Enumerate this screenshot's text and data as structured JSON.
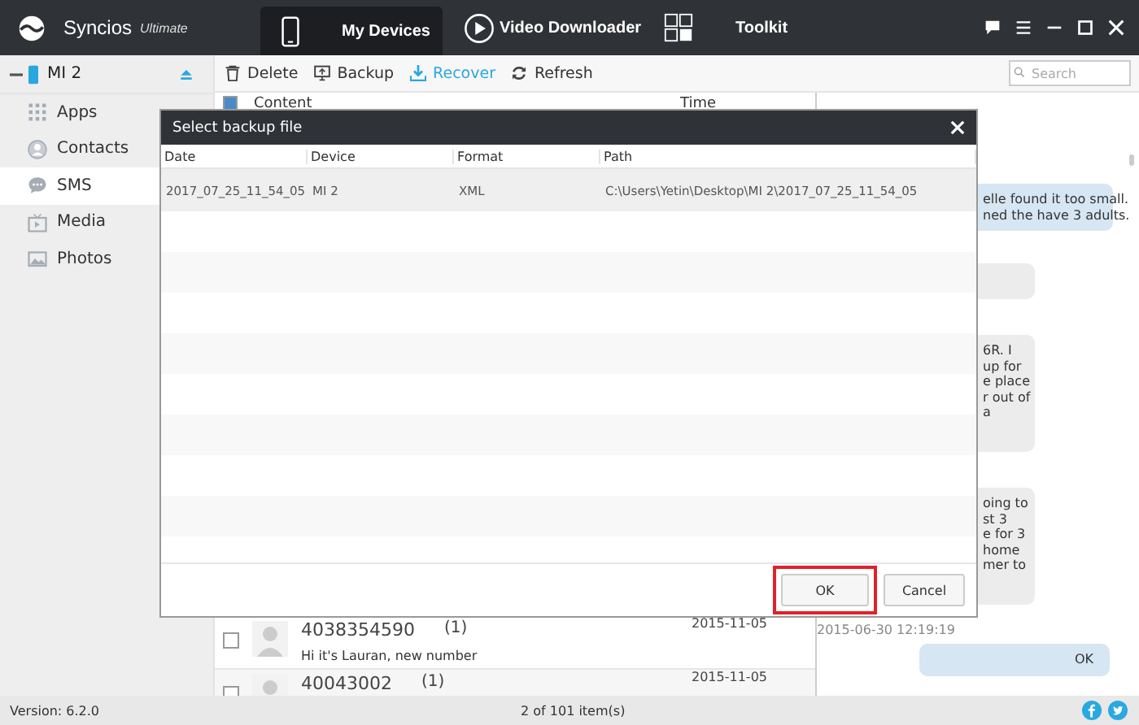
{
  "app": {
    "name": "Syncios",
    "edition": "Ultimate"
  },
  "nav_tabs": [
    {
      "label": "My Devices",
      "selected": true
    },
    {
      "label": "Video Downloader",
      "selected": false
    },
    {
      "label": "Toolkit",
      "selected": false
    }
  ],
  "device": {
    "name": "MI 2"
  },
  "sidebar": [
    {
      "label": "Apps",
      "selected": false
    },
    {
      "label": "Contacts",
      "selected": false
    },
    {
      "label": "SMS",
      "selected": true
    },
    {
      "label": "Media",
      "selected": false
    },
    {
      "label": "Photos",
      "selected": false
    }
  ],
  "toolbar": [
    {
      "label": "Delete",
      "active": false
    },
    {
      "label": "Backup",
      "active": false
    },
    {
      "label": "Recover",
      "active": true
    },
    {
      "label": "Refresh",
      "active": false
    }
  ],
  "search": {
    "placeholder": "Search"
  },
  "list": {
    "select_all_checked": true,
    "columns": [
      "Content",
      "Time"
    ],
    "rows": [
      {
        "contact": "4038354590",
        "count": "(1)",
        "preview": "Hi it's Lauran, new number",
        "time": "2015-11-05",
        "checked": false
      },
      {
        "contact": "40043002",
        "count": "(1)",
        "time": "2015-11-05",
        "checked": false
      }
    ]
  },
  "chat": [
    {
      "kind": "sent",
      "lines": [
        "elle found it too small.",
        "ned the have 3 adults."
      ]
    },
    {
      "kind": "received"
    },
    {
      "kind": "received",
      "lines": [
        "6R. I",
        "up for",
        "e place",
        "r out of",
        "a"
      ]
    },
    {
      "kind": "received",
      "lines": [
        "oing to",
        "st 3",
        "e for 3",
        "home",
        "mer to"
      ]
    },
    {
      "kind": "timestamp",
      "lines": [
        "2015-06-30 12:19:19"
      ]
    },
    {
      "kind": "sent",
      "lines": [
        "OK"
      ]
    }
  ],
  "dialog": {
    "title": "Select backup file",
    "columns": [
      "Date",
      "Device",
      "Format",
      "Path"
    ],
    "rows": [
      {
        "cells": [
          "2017_07_25_11_54_05",
          "MI 2",
          "XML",
          "C:\\Users\\Yetin\\Desktop\\MI 2\\2017_07_25_11_54_05"
        ],
        "selected": true
      }
    ],
    "buttons": [
      {
        "label": "OK",
        "highlighted": true
      },
      {
        "label": "Cancel",
        "highlighted": false
      }
    ]
  },
  "status_bar": {
    "version": "Version: 6.2.0",
    "count": "2 of 101 item(s)"
  }
}
